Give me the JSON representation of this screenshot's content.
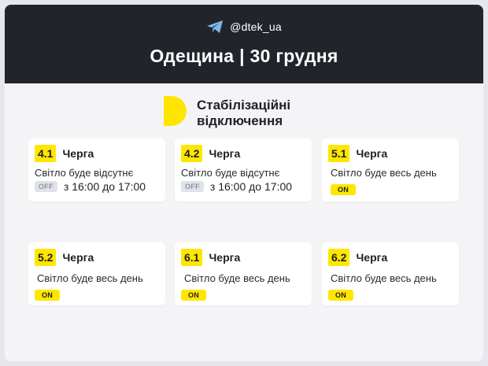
{
  "header": {
    "telegram_icon": "telegram-icon",
    "handle": "@dtek_ua",
    "title": "Одещина | 30 грудня"
  },
  "brand": {
    "logo_icon": "dtek-d-logo",
    "line1": "Стабілізаційні",
    "line2": "відключення"
  },
  "colors": {
    "header_bg": "#22242c",
    "accent_yellow": "#ffe600",
    "off_badge_bg": "#dfe2e8"
  },
  "queue_word": "Черга",
  "cards": [
    {
      "number": "4.1",
      "queue": "Черга",
      "status": "Світло буде відсутнє",
      "badge": "OFF",
      "time": "з 16:00 до 17:00"
    },
    {
      "number": "4.2",
      "queue": "Черга",
      "status": "Світло буде відсутнє",
      "badge": "OFF",
      "time": "з 16:00 до 17:00"
    },
    {
      "number": "5.1",
      "queue": "Черга",
      "status": "Світло буде весь день",
      "badge": "ON"
    },
    {
      "number": "5.2",
      "queue": "Черга",
      "status": "Світло буде весь день",
      "badge": "ON"
    },
    {
      "number": "6.1",
      "queue": "Черга",
      "status": "Світло буде весь день",
      "badge": "ON"
    },
    {
      "number": "6.2",
      "queue": "Черга",
      "status": "Світло буде весь день",
      "badge": "ON"
    }
  ]
}
